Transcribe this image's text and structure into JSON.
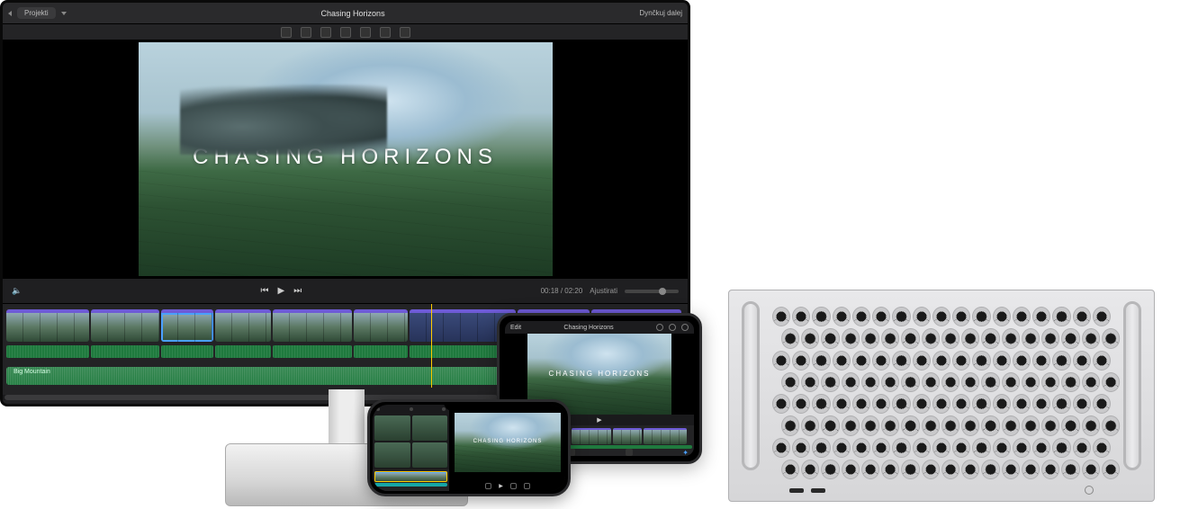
{
  "project": {
    "title": "Chasing Horizons",
    "video_overlay_title": "CHASING HORIZONS"
  },
  "monitor_imovie": {
    "back_label": "Projekti",
    "title": "Chasing Horizons",
    "share_label": "Dynčkuj dalej",
    "timecode": "00:18 / 02:20",
    "settings_label": "Ajustirati",
    "music_track_label": "Big Mountain"
  },
  "ipad": {
    "back_label": "Edit",
    "title": "Chasing Horizons",
    "overlay_title": "CHASING HORIZONS"
  },
  "iphone": {
    "overlay_title": "CHASING HORIZONS"
  },
  "timeline": {
    "video_clips": [
      {
        "w": 92,
        "sel": false
      },
      {
        "w": 76,
        "sel": false
      },
      {
        "w": 58,
        "sel": true
      },
      {
        "w": 62,
        "sel": false
      },
      {
        "w": 88,
        "sel": false
      },
      {
        "w": 60,
        "sel": false
      },
      {
        "w": 118,
        "sel": false,
        "title": true
      },
      {
        "w": 80,
        "sel": false
      },
      {
        "w": 100,
        "sel": false
      }
    ],
    "audio_clips": [
      92,
      76,
      58,
      62,
      88,
      60,
      118
    ]
  },
  "ipad_timeline": {
    "clips": [
      38,
      30,
      44,
      32,
      48
    ]
  }
}
